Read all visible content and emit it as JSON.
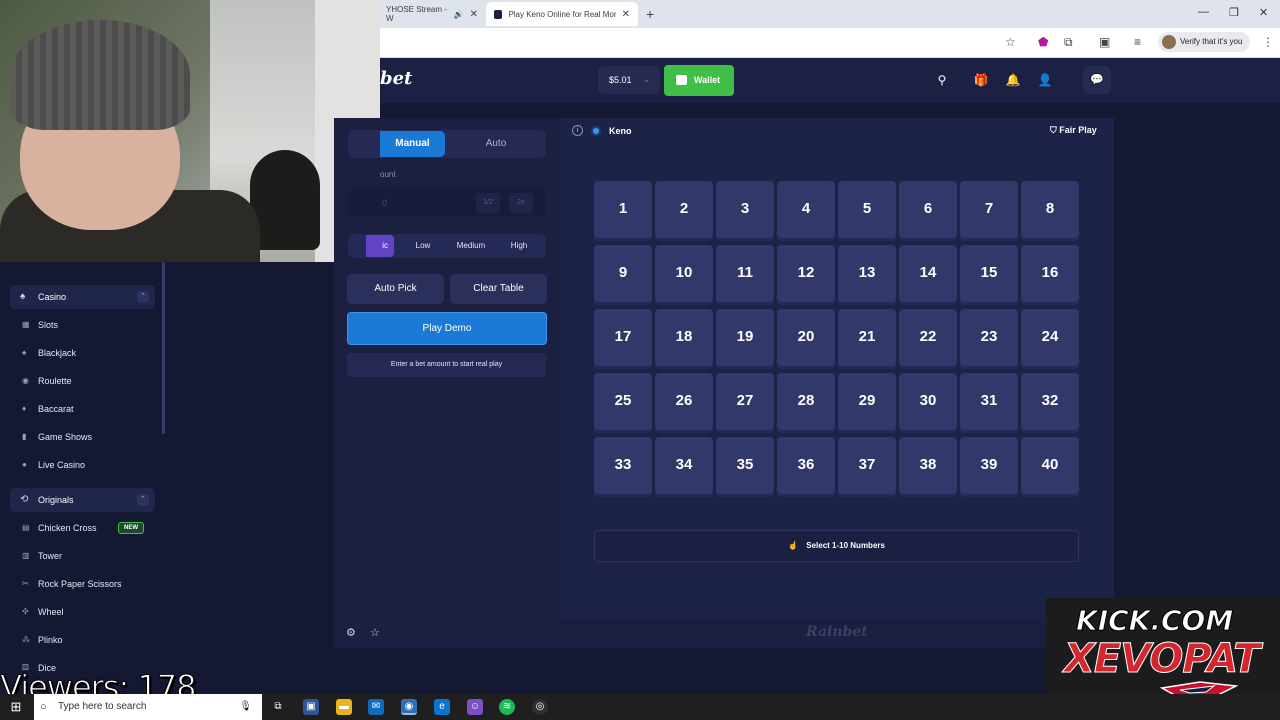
{
  "browser": {
    "tabs": [
      {
        "title": "YHOSE Stream - W",
        "active": false
      },
      {
        "title": "Play Keno Online for Real Mone",
        "active": true
      }
    ],
    "new_tab": "+",
    "verify_label": "Verify that it's you"
  },
  "header": {
    "logo": "Rainbet",
    "logo_visible": "bet",
    "balance": "$5.01",
    "wallet_label": "Wallet"
  },
  "sidebar": {
    "groups": [
      {
        "label": "Casino",
        "icon": "casino-icon"
      },
      {
        "label": "Originals",
        "icon": "originals-icon"
      }
    ],
    "casino_items": [
      {
        "label": "Slots",
        "icon": "slots-icon"
      },
      {
        "label": "Blackjack",
        "icon": "blackjack-icon"
      },
      {
        "label": "Roulette",
        "icon": "roulette-icon"
      },
      {
        "label": "Baccarat",
        "icon": "baccarat-icon"
      },
      {
        "label": "Game Shows",
        "icon": "game-shows-icon"
      },
      {
        "label": "Live Casino",
        "icon": "live-casino-icon"
      }
    ],
    "original_items": [
      {
        "label": "Chicken Cross",
        "icon": "chicken-cross-icon",
        "badge": "NEW"
      },
      {
        "label": "Tower",
        "icon": "tower-icon"
      },
      {
        "label": "Rock Paper Scissors",
        "icon": "rps-icon"
      },
      {
        "label": "Wheel",
        "icon": "wheel-icon"
      },
      {
        "label": "Plinko",
        "icon": "plinko-icon"
      },
      {
        "label": "Dice",
        "icon": "dice-icon"
      }
    ]
  },
  "panel": {
    "tab_manual": "Manual",
    "tab_auto": "Auto",
    "amount_label": "ount",
    "amount_value": "0",
    "half_btn": "1/2",
    "double_btn": "2x",
    "risk_selected": "ic",
    "risk_options": [
      "Low",
      "Medium",
      "High"
    ],
    "auto_pick": "Auto Pick",
    "clear_table": "Clear Table",
    "play_demo": "Play Demo",
    "hint": "Enter a bet amount to start real play"
  },
  "board": {
    "game_name": "Keno",
    "fair_play": "Fair Play",
    "numbers": [
      "1",
      "2",
      "3",
      "4",
      "5",
      "6",
      "7",
      "8",
      "9",
      "10",
      "11",
      "12",
      "13",
      "14",
      "15",
      "16",
      "17",
      "18",
      "19",
      "20",
      "21",
      "22",
      "23",
      "24",
      "25",
      "26",
      "27",
      "28",
      "29",
      "30",
      "31",
      "32",
      "33",
      "34",
      "35",
      "36",
      "37",
      "38",
      "39",
      "40"
    ],
    "select_hint": "Select 1-10 Numbers",
    "watermark": "Rainbet"
  },
  "overlay": {
    "viewers": "Viewers: 178",
    "kick_line1": "KICK.COM",
    "kick_line2": "XEVOPAT"
  },
  "taskbar": {
    "search_placeholder": "Type here to search"
  },
  "colors": {
    "accent_blue": "#1a7ad6",
    "wallet_green": "#3fbf45",
    "tile": "#33386a",
    "page_bg": "#141833"
  }
}
